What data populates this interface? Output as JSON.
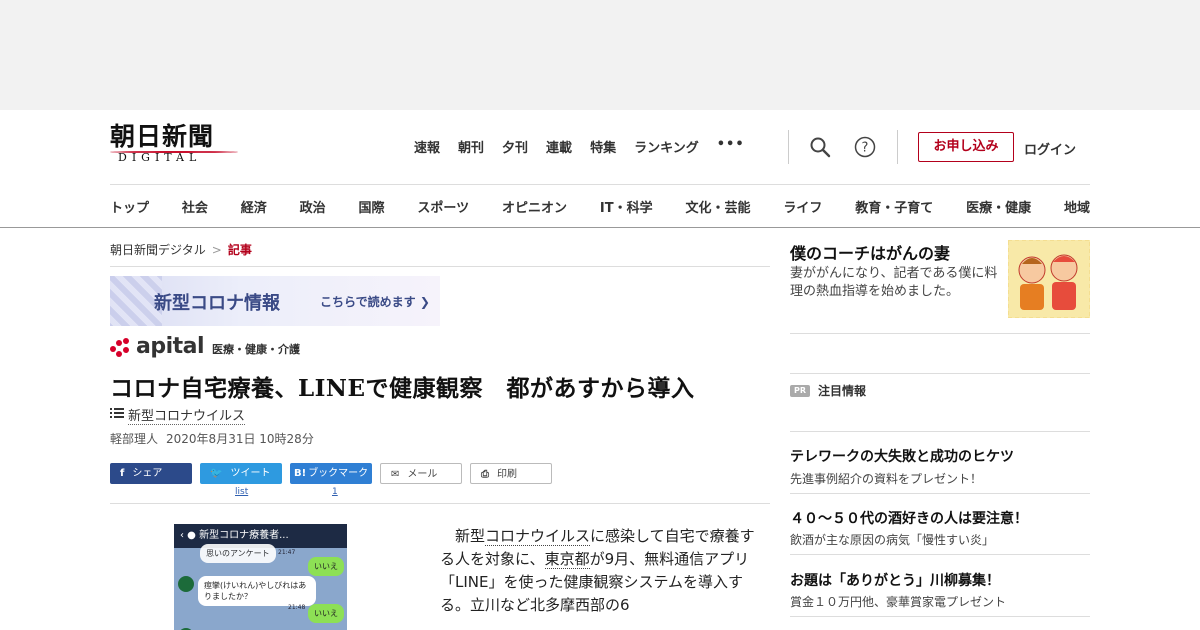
{
  "logo": {
    "main": "朝日新聞",
    "sub": "DIGITAL"
  },
  "header_nav": [
    "速報",
    "朝刊",
    "夕刊",
    "連載",
    "特集",
    "ランキング"
  ],
  "header_more": "•••",
  "signup_label": "お申し込み",
  "login_label": "ログイン",
  "categories": [
    "トップ",
    "社会",
    "経済",
    "政治",
    "国際",
    "スポーツ",
    "オピニオン",
    "IT・科学",
    "文化・芸能",
    "ライフ",
    "教育・子育て",
    "医療・健康",
    "地域"
  ],
  "breadcrumb": {
    "home": "朝日新聞デジタル",
    "separator": ">",
    "current": "記事"
  },
  "banner": {
    "title": "新型コロナ情報",
    "link": "こちらで読めます"
  },
  "apital": {
    "word": "apital",
    "tag": "医療・健康・介護"
  },
  "article": {
    "headline": "コロナ自宅療養、LINEで健康観察　都があすから導入",
    "topic": "新型コロナウイルス",
    "author": "軽部理人",
    "date": "2020年8月31日 10時28分",
    "body": {
      "p1": "新型",
      "p1_link": "コロナウイルス",
      "p2": "に感染して自宅で療養する人を対象に、",
      "p2_link": "東京都",
      "p3": "が9月、無料通信アプリ「LINE」を使った健康観察システムを導入する。立川など北多摩西部の6"
    }
  },
  "share": {
    "facebook": "シェア",
    "twitter": "ツイート",
    "twitter_count": "list",
    "hatena": "ブックマーク",
    "hatena_count": "1",
    "mail": "メール",
    "print": "印刷"
  },
  "photo": {
    "bar_title": "新型コロナ療養者...",
    "bubble1": "思いのアンケート",
    "reply": "いいえ",
    "question": "痙攣(けいれん)やしびれはありましたか？",
    "time1": "21:47",
    "time2": "21:48"
  },
  "sidebar": {
    "feature": {
      "title": "僕のコーチはがんの妻",
      "desc": "妻ががんになり、記者である僕に料理の熱血指導を始めました。"
    },
    "pr_badge": "PR",
    "pr_label": "注目情報",
    "pr_items": [
      {
        "title": "テレワークの大失敗と成功のヒケツ",
        "sub": "先進事例紹介の資料をプレゼント！"
      },
      {
        "title": "４０～５０代の酒好きの人は要注意！",
        "sub": "飲酒が主な原因の病気「慢性すい炎」"
      },
      {
        "title": "お題は「ありがとう」川柳募集！",
        "sub": "賞金１０万円他、豪華賞家電プレゼント"
      }
    ]
  },
  "colors": {
    "accent": "#b3001b",
    "facebook": "#2c4a8a",
    "twitter": "#2e9ae0",
    "hatena": "#2f7fd4"
  }
}
